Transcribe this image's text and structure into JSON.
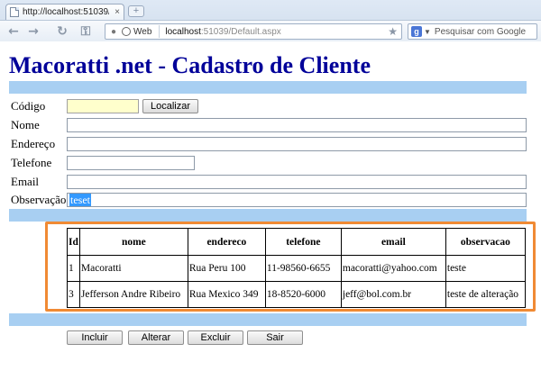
{
  "browser": {
    "tab_title": "http://localhost:51039/...",
    "tab_close": "×",
    "new_tab": "+",
    "nav": {
      "back": "←",
      "forward": "→",
      "reload": "↻",
      "key": "⚿"
    },
    "omnibox": {
      "web_label": "Web",
      "host": "localhost",
      "path": ":51039/Default.aspx"
    },
    "search_placeholder": "Pesquisar com Google",
    "search_engine_icon": "google-icon",
    "bookmark_icon": "star-icon"
  },
  "page": {
    "title": "Macoratti .net - Cadastro de Cliente",
    "band_color": "#a8cff2",
    "title_color": "#000099",
    "highlight_color": "#f08a34"
  },
  "form": {
    "codigo_label": "Código",
    "codigo_value": "",
    "localizar_label": "Localizar",
    "nome_label": "Nome",
    "nome_value": "",
    "endereco_label": "Endereço",
    "endereco_value": "",
    "telefone_label": "Telefone",
    "telefone_value": "",
    "email_label": "Email",
    "email_value": "",
    "observacao_label": "Observação",
    "observacao_value": "teset"
  },
  "grid": {
    "columns": [
      "Id",
      "nome",
      "endereco",
      "telefone",
      "email",
      "observacao"
    ],
    "rows": [
      [
        "1",
        "Macoratti",
        "Rua Peru 100",
        "11-98560-6655",
        "macoratti@yahoo.com",
        "teste"
      ],
      [
        "3",
        "Jefferson Andre Ribeiro",
        "Rua Mexico 349",
        "18-8520-6000",
        "jeff@bol.com.br",
        "teste de alteração"
      ]
    ]
  },
  "actions": {
    "incluir": "Incluir",
    "alterar": "Alterar",
    "excluir": "Excluir",
    "sair": "Sair"
  }
}
